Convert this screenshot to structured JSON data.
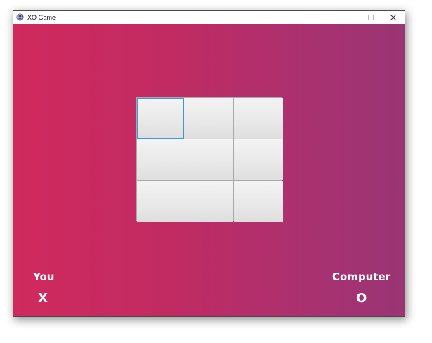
{
  "window": {
    "title": "XO Game",
    "app_icon": "globe-icon",
    "controls": [
      "minimize-icon",
      "maximize-icon",
      "close-icon"
    ]
  },
  "colors": {
    "gradient_left": "#d02a5e",
    "gradient_right": "#9a3574",
    "cell_bg": "#ececec",
    "focus_border": "#3b99d4",
    "text": "#ffffff"
  },
  "board": {
    "cells": [
      "",
      "",
      "",
      "",
      "",
      "",
      "",
      "",
      ""
    ],
    "focused_cell": 0
  },
  "players": {
    "you": {
      "label": "You",
      "mark": "X"
    },
    "computer": {
      "label": "Computer",
      "mark": "O"
    }
  }
}
